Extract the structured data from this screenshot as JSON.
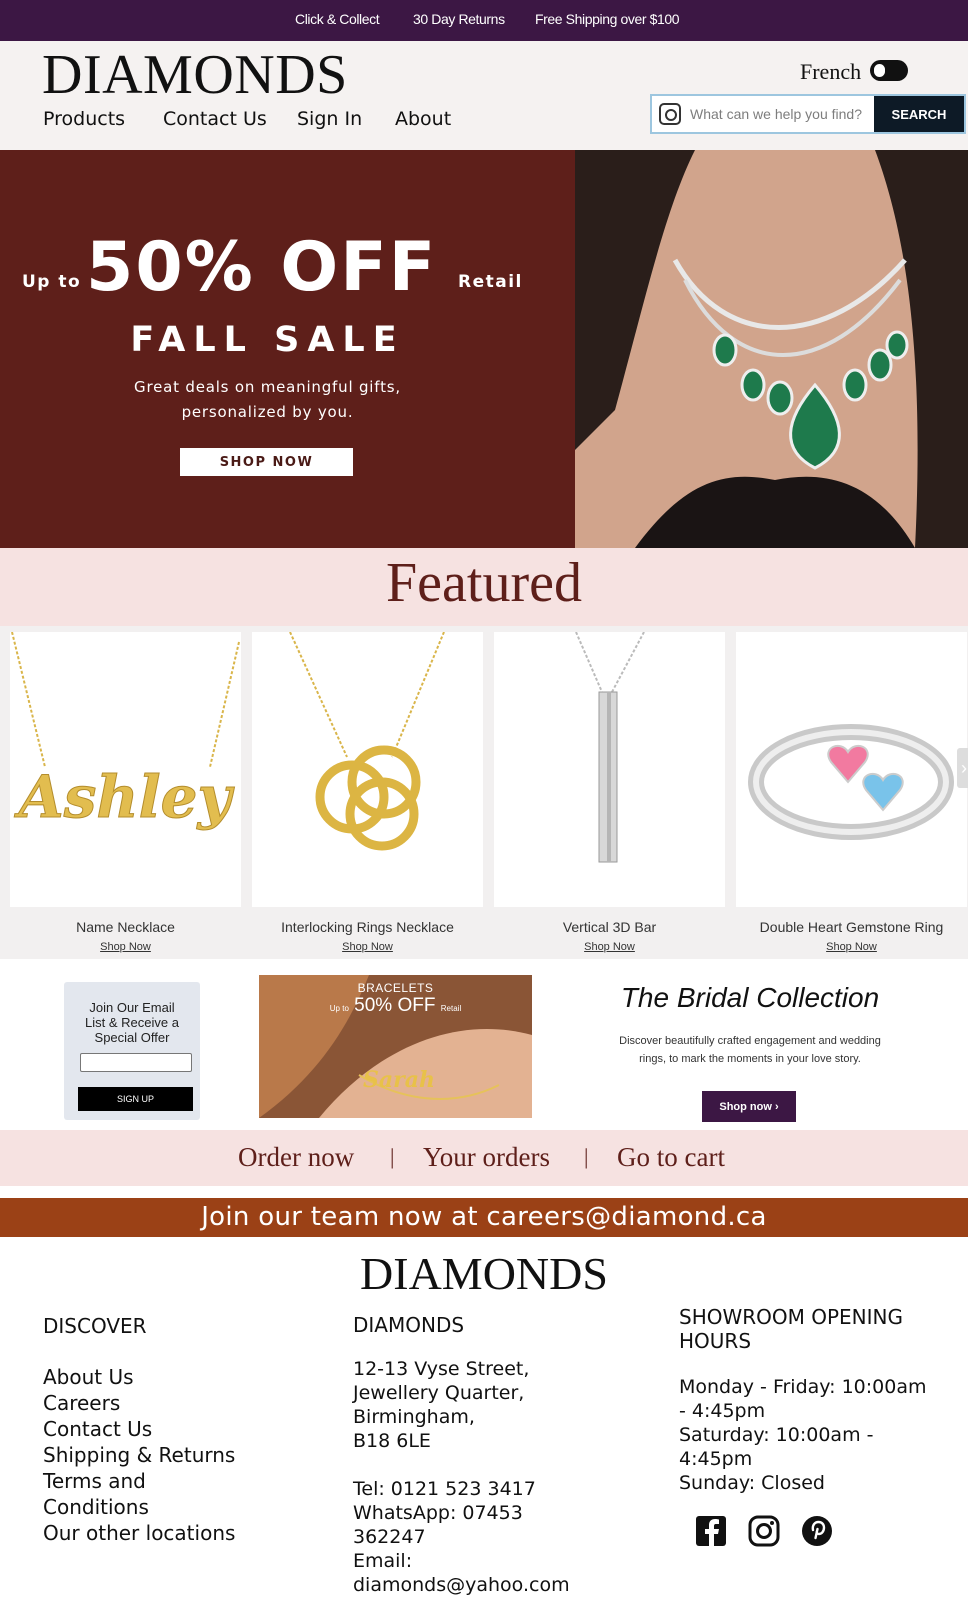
{
  "topbar": {
    "click_collect": "Click & Collect",
    "returns": "30 Day Returns",
    "shipping": "Free Shipping over $100"
  },
  "header": {
    "logo": "DIAMONDS",
    "nav": [
      "Products",
      "Contact Us",
      "Sign In",
      "About"
    ],
    "language_label": "French",
    "search_placeholder": "What can we help you find?",
    "search_button": "SEARCH"
  },
  "hero": {
    "up_to": "Up to",
    "headline": "50% OFF",
    "retail": "Retail",
    "sale": "FALL SALE",
    "subtitle_line1": "Great deals on meaningful gifts,",
    "subtitle_line2": "personalized by you.",
    "cta": "SHOP NOW"
  },
  "featured": {
    "title": "Featured",
    "products": [
      {
        "name": "Name Necklace",
        "cta": "Shop Now",
        "engraving": "Ashley"
      },
      {
        "name": "Interlocking Rings Necklace",
        "cta": "Shop Now"
      },
      {
        "name": "Vertical 3D Bar",
        "cta": "Shop Now"
      },
      {
        "name": "Double Heart Gemstone Ring",
        "cta": "Shop Now"
      }
    ]
  },
  "signup": {
    "line1": "Join Our Email",
    "line2": "List & Receive a",
    "line3": "Special Offer",
    "button": "SIGN UP"
  },
  "bracelets": {
    "title": "BRACELETS",
    "up_to": "Up to",
    "offer": "50% OFF",
    "retail": "Retail",
    "engraving": "Sarah"
  },
  "bridal": {
    "title": "The Bridal Collection",
    "desc_line1": "Discover beautifully crafted engagement and wedding",
    "desc_line2": "rings, to mark the moments in your love story.",
    "cta": "Shop now ›"
  },
  "order_links": {
    "order_now": "Order now",
    "your_orders": "Your orders",
    "go_to_cart": "Go to cart",
    "separator": "|"
  },
  "careers": "Join our team now at careers@diamond.ca",
  "footer": {
    "logo": "DIAMONDS",
    "discover": {
      "heading": "DISCOVER",
      "links": [
        "About Us",
        "Careers",
        "Contact Us",
        "Shipping & Returns",
        "Terms and",
        "Conditions",
        "Our other locations"
      ]
    },
    "address": {
      "heading": "DIAMONDS",
      "lines": [
        "12-13 Vyse Street,",
        "Jewellery Quarter,",
        "Birmingham,",
        "B18 6LE"
      ],
      "tel": "Tel: 0121 523 3417",
      "whatsapp_1": "WhatsApp: 07453",
      "whatsapp_2": "362247",
      "email_label": "Email:",
      "email": "diamonds@yahoo.com"
    },
    "hours": {
      "heading_1": "SHOWROOM OPENING",
      "heading_2": "HOURS",
      "lines": [
        "Monday - Friday: 10:00am",
        "- 4:45pm",
        "Saturday: 10:00am -",
        "4:45pm",
        "Sunday: Closed"
      ]
    },
    "social_icons": [
      "facebook-icon",
      "instagram-icon",
      "pinterest-icon"
    ]
  },
  "colors": {
    "topbar": "#3c1744",
    "hero_bg": "#5e1f1a",
    "pink_strip": "#f6e2e1",
    "careers_bg": "#9b4116"
  }
}
